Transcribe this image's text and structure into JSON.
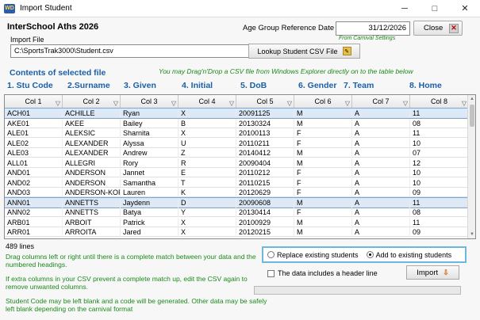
{
  "window": {
    "title": "Import Student",
    "icon": "wd-app-icon",
    "minimize_icon": "minimize-icon",
    "maximize_icon": "maximize-icon",
    "close_icon": "close-icon"
  },
  "header": {
    "school": "InterSchool Aths 2026",
    "age_label": "Age Group Reference Date",
    "age_date": "31/12/2026",
    "from_carnival": "From Carnival Settings",
    "close_label": "Close"
  },
  "import": {
    "file_label": "Import File",
    "path": "C:\\SportsTrak3000\\Student.csv",
    "lookup_label": "Lookup Student CSV File",
    "drag_note": "You may Drag'n'Drop a CSV file from Windows Explorer directly on to the table below"
  },
  "contents_title": "Contents of selected file",
  "fields": [
    "1. Stu Code",
    "2.Surname",
    "3. Given",
    "4. Initial",
    "5. DoB",
    "6. Gender",
    "7. Team",
    "8. Home"
  ],
  "grid": {
    "columns": [
      "Col 1",
      "Col 2",
      "Col 3",
      "Col 4",
      "Col 5",
      "Col 6",
      "Col 7",
      "Col 8"
    ],
    "rows": [
      [
        "ACH01",
        "ACHILLE",
        "Ryan",
        "X",
        "20091125",
        "M",
        "A",
        "11"
      ],
      [
        "AKE01",
        "AKEE",
        "Bailey",
        "B",
        "20130324",
        "M",
        "A",
        "08"
      ],
      [
        "ALE01",
        "ALEKSIC",
        "Sharnita",
        "X",
        "20100113",
        "F",
        "A",
        "11"
      ],
      [
        "ALE02",
        "ALEXANDER",
        "Alyssa",
        "U",
        "20110211",
        "F",
        "A",
        "10"
      ],
      [
        "ALE03",
        "ALEXANDER",
        "Andrew",
        "Z",
        "20140412",
        "M",
        "A",
        "07"
      ],
      [
        "ALL01",
        "ALLEGRI",
        "Rory",
        "R",
        "20090404",
        "M",
        "A",
        "12"
      ],
      [
        "AND01",
        "ANDERSON",
        "Jannet",
        "E",
        "20110212",
        "F",
        "A",
        "10"
      ],
      [
        "AND02",
        "ANDERSON",
        "Samantha",
        "T",
        "20110215",
        "F",
        "A",
        "10"
      ],
      [
        "AND03",
        "ANDERSON-KOF",
        "Lauren",
        "K",
        "20120629",
        "F",
        "A",
        "09"
      ],
      [
        "ANN01",
        "ANNETTS",
        "Jaydenn",
        "D",
        "20090608",
        "M",
        "A",
        "11"
      ],
      [
        "ANN02",
        "ANNETTS",
        "Batya",
        "Y",
        "20130414",
        "F",
        "A",
        "08"
      ],
      [
        "ARB01",
        "ARBOIT",
        "Patrick",
        "X",
        "20100929",
        "M",
        "A",
        "11"
      ],
      [
        "ARR01",
        "ARROITA",
        "Jared",
        "X",
        "20120215",
        "M",
        "A",
        "09"
      ]
    ],
    "selected_rows": [
      0,
      9
    ],
    "filter_icon": "filter-icon"
  },
  "lines_count": "489 lines",
  "notes": [
    "Drag columns left or right until there is a complete match between your data and the numbered headings.",
    "If extra columns in your CSV prevent a complete match up, edit the CSV again to remove unwanted columns.",
    "Student Code may be left blank and a code will be generated. Other data may be safely left blank depending on the carnival format"
  ],
  "options": {
    "replace_label": "Replace existing students",
    "add_label": "Add to existing students",
    "selected": "add",
    "header_line_label": "The data includes a header line",
    "header_line_checked": false
  },
  "import_label": "Import",
  "progress": 0
}
